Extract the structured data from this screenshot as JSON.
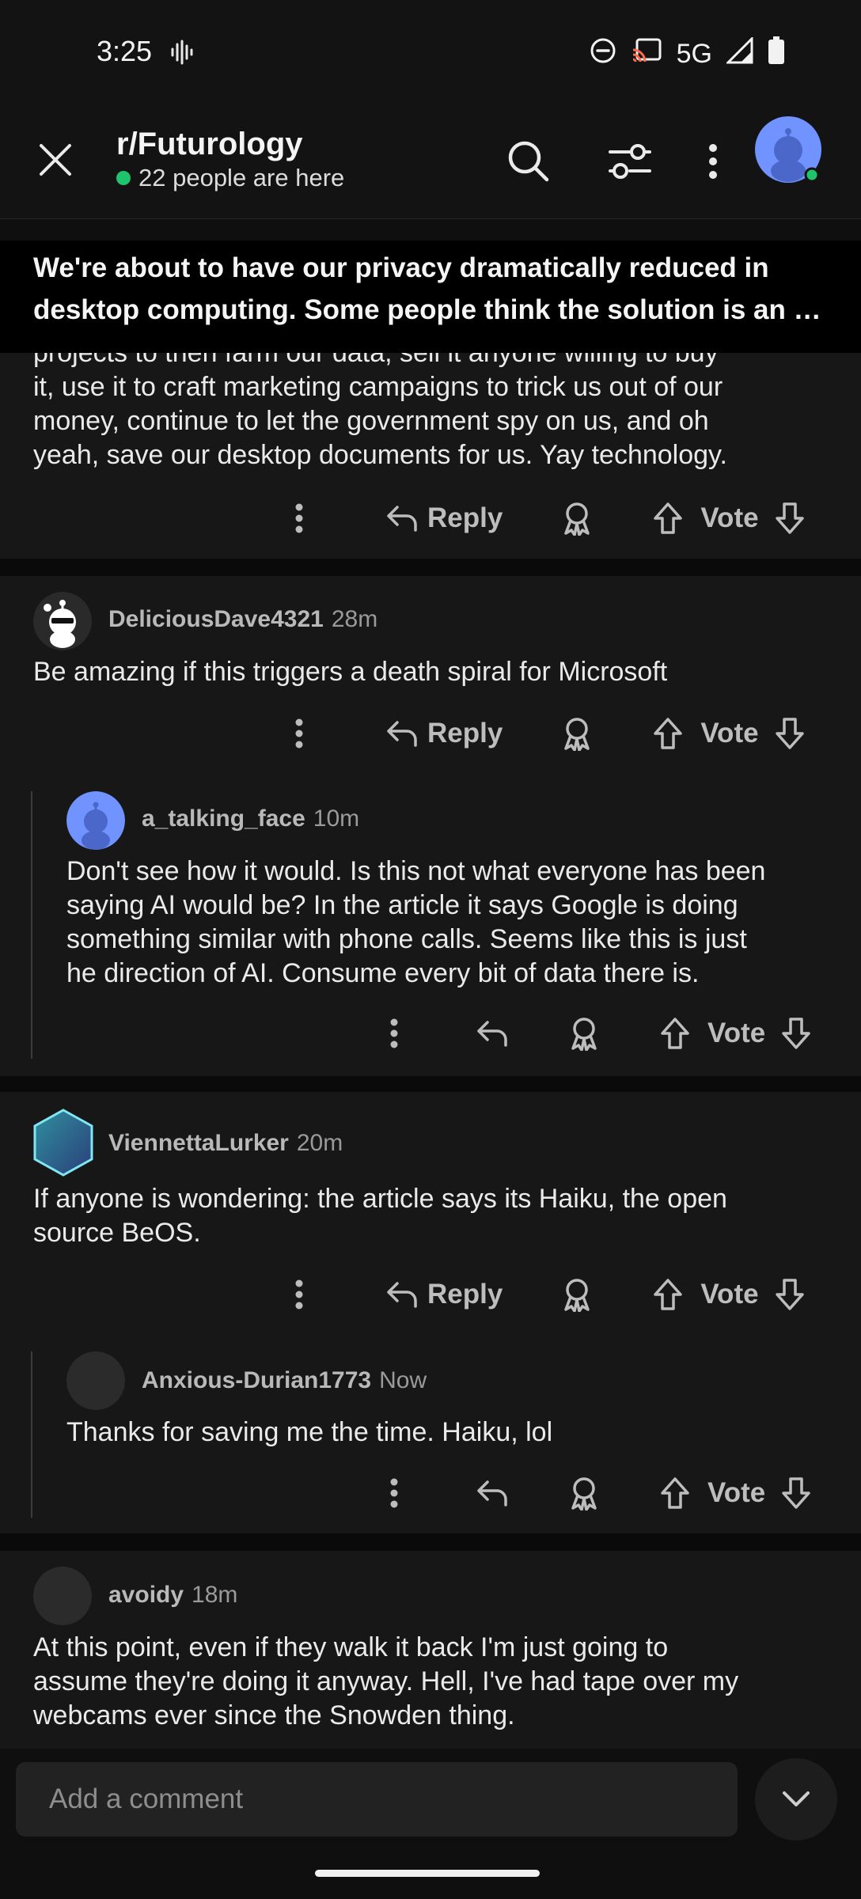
{
  "status": {
    "time": "3:25",
    "network": "5G"
  },
  "header": {
    "subreddit": "r/Futurology",
    "online": "22 people are here"
  },
  "post": {
    "title_line1": "We're about to have our privacy dramatically reduced in",
    "title_line2": "desktop computing. Some people think the solution is an op..."
  },
  "partial_comment": {
    "lines": [
      "projects to then farm our data, sell it anyone willing to buy",
      "it, use it to craft marketing campaigns to trick us out of our",
      "money, continue to let the government spy on us, and oh",
      "yeah, save our desktop documents for us. Yay technology."
    ]
  },
  "labels": {
    "reply": "Reply",
    "vote": "Vote"
  },
  "comments": [
    {
      "user": "DeliciousDave4321",
      "time": "28m",
      "lines": [
        "Be amazing if this triggers a death spiral for Microsoft"
      ]
    },
    {
      "user": "a_talking_face",
      "time": "10m",
      "lines": [
        "Don't see how it would. Is this not what everyone has been",
        "saying AI would be? In the article it says Google is doing",
        "something similar with phone calls. Seems like this is just",
        "he direction of AI. Consume every bit of data there is."
      ]
    },
    {
      "user": "ViennettaLurker",
      "time": "20m",
      "lines": [
        "If anyone is wondering: the article says its Haiku, the open",
        "source BeOS."
      ]
    },
    {
      "user": "Anxious-Durian1773",
      "time": "Now",
      "lines": [
        "Thanks for saving me the time. Haiku, lol"
      ]
    },
    {
      "user": "avoidy",
      "time": "18m",
      "lines": [
        "At this point, even if they walk it back I'm just going to",
        "assume they're doing it anyway. Hell, I've had tape over my",
        "webcams ever since the Snowden thing."
      ]
    }
  ],
  "composer": {
    "placeholder": "Add a comment"
  },
  "colors": {
    "online": "#1ec46b",
    "background": "#171718",
    "avatar_blue": "#7193ff"
  }
}
